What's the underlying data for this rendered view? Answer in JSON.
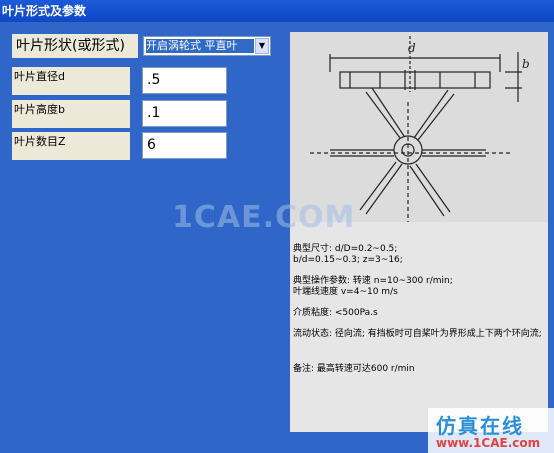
{
  "window": {
    "title": "叶片形式及参数"
  },
  "form": {
    "type_label": "叶片形状(或形式)",
    "type_value": "开启涡轮式  平直叶",
    "diameter_label": "叶片直径d",
    "diameter_value": ".5",
    "height_label": "叶片高度b",
    "height_value": ".1",
    "count_label": "叶片数目Z",
    "count_value": "6"
  },
  "figure": {
    "dim_d": "d",
    "dim_b": "b"
  },
  "info": {
    "size": "典型尺寸: d/D=0.2~0.5;",
    "size2": "b/d=0.15~0.3;  z=3~16;",
    "op": "典型操作参数: 转速 n=10~300 r/min;",
    "op2": "叶端线速度 v=4~10 m/s",
    "visc": "介质粘度:    <500Pa.s",
    "flow": "流动状态: 径向流; 有挡板时可自桨叶为界形成上下两个环向流;",
    "note": "备注: 最高转速可达600 r/min"
  },
  "watermark": {
    "center": "1CAE.COM",
    "brand_cn": "仿真在线",
    "brand_url": "www.1CAE.com"
  }
}
